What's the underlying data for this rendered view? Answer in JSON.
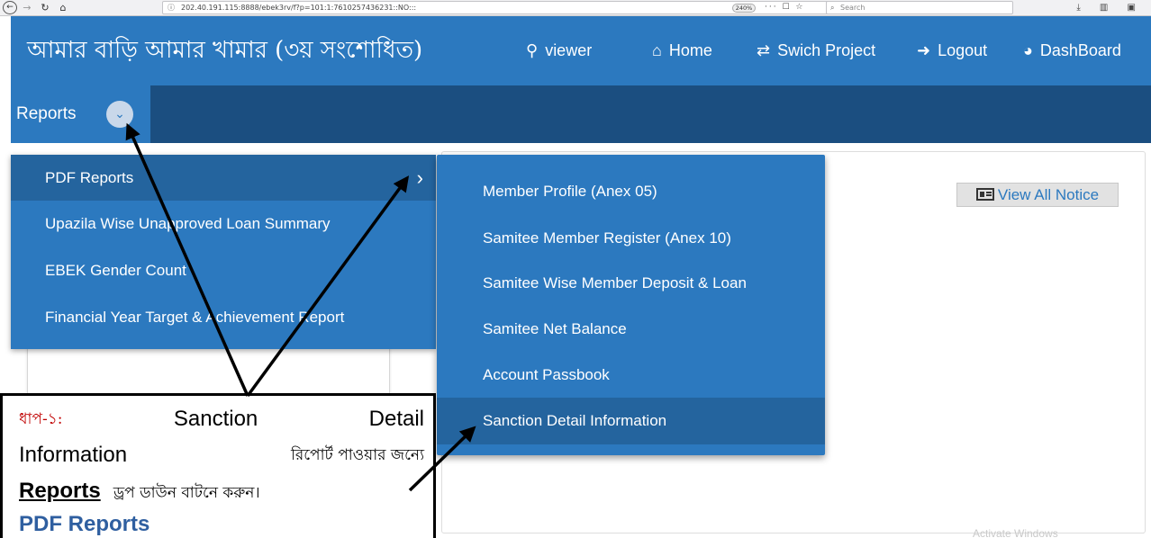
{
  "browser": {
    "back_icon": "back-icon",
    "url_info_icon": "info-icon",
    "url": "202.40.191.115:8888/ebek3rv/f?p=101:1:7610257436231::NO:::",
    "zoom": "240%",
    "search_placeholder": "Search"
  },
  "header": {
    "title": "আমার বাড়ি আমার খামার (৩য় সংশোধিত)",
    "nav": [
      {
        "label": "viewer",
        "icon": "user-icon"
      },
      {
        "label": "Home",
        "icon": "home-icon"
      },
      {
        "label": "Swich Project",
        "icon": "exchange-icon"
      },
      {
        "label": "Logout",
        "icon": "logout-icon"
      },
      {
        "label": "DashBoard",
        "icon": "dashboard-icon"
      }
    ]
  },
  "subnav": {
    "reports_label": "Reports"
  },
  "main_menu": {
    "items": [
      {
        "label": "PDF Reports",
        "active": true
      },
      {
        "label": "Upazila Wise Unapproved Loan Summary"
      },
      {
        "label": "EBEK Gender Count"
      },
      {
        "label": "Financial Year Target & Achievement Report"
      }
    ]
  },
  "sub_menu": {
    "items": [
      {
        "label": "Member Profile (Anex 05)"
      },
      {
        "label": "Samitee Member Register (Anex 10)"
      },
      {
        "label": "Samitee Wise Member Deposit & Loan"
      },
      {
        "label": "Samitee Net Balance"
      },
      {
        "label": "Account Passbook"
      },
      {
        "label": "Sanction Detail Information",
        "active": true
      }
    ]
  },
  "notice": {
    "button_label": "View All Notice"
  },
  "watermark": "Activate Windows",
  "callout": {
    "step_label": "ধাপ-১:",
    "line1_a": "Sanction",
    "line1_b": "Detail",
    "line2_a": "Information",
    "line2_b": "রিপোর্ট পাওয়ার জন্যে",
    "line3_bold": "Reports",
    "line3_text": "ড্রপ ডাউন বাটনে করুন।",
    "line4": "PDF Reports"
  },
  "colors": {
    "header_bg": "#2c79bf",
    "subnav_bg": "#1b4e80",
    "menu_active": "#24649e",
    "step_label": "#c00000"
  }
}
